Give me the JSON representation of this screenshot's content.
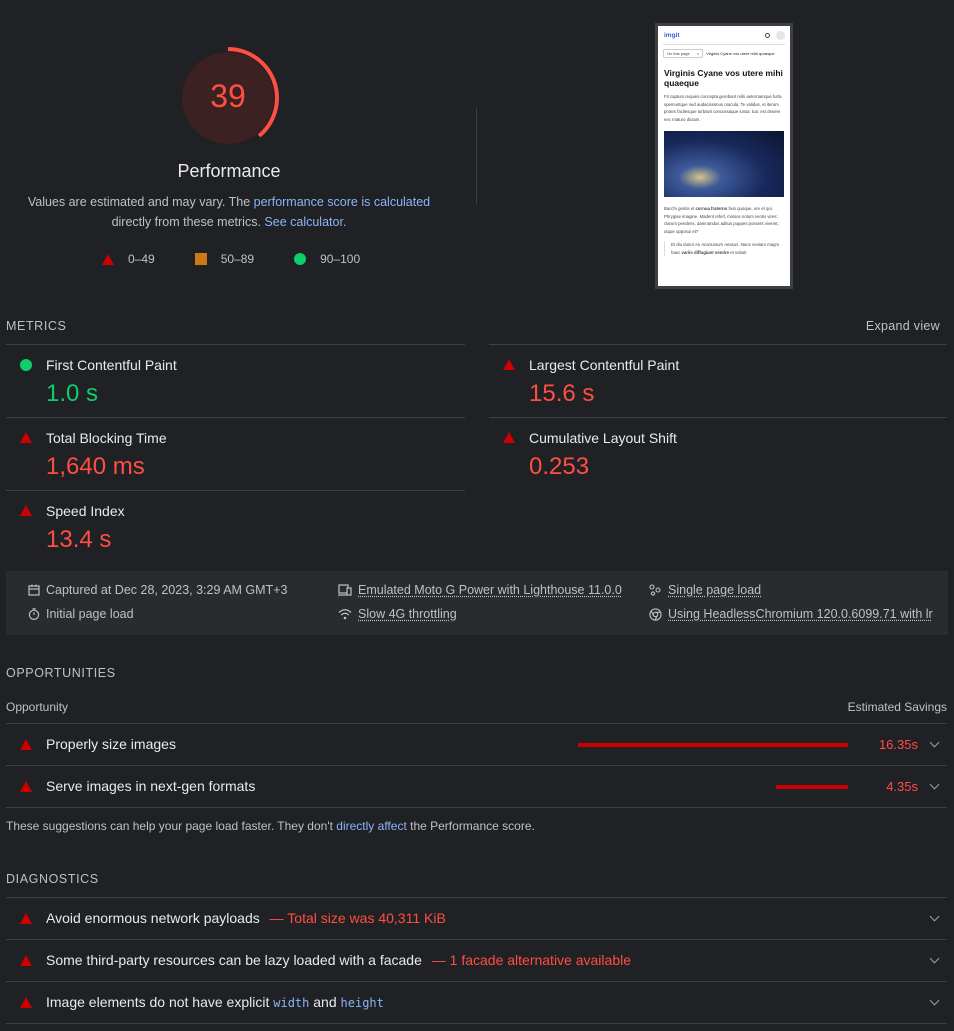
{
  "gauge": {
    "score": "39",
    "title": "Performance",
    "fraction": 0.39,
    "color": "#ff4e42"
  },
  "intro": {
    "text1": "Values are estimated and may vary. The ",
    "link1": "performance score is calculated",
    "text2": "directly from these metrics. ",
    "link2": "See calculator."
  },
  "legend": {
    "fail": "0–49",
    "average": "50–89",
    "pass": "90–100"
  },
  "screenshot": {
    "brand": "imgit",
    "toc_label": "On this page",
    "toc_close": "×",
    "toc_title": "Virginis Cyane vos utere mihi quaeque",
    "heading": "Virginis Cyane vos utere mihi quaeque",
    "para1": "Fit captum requies concepta gerebant mihi aeternamque furta spemuntque sed audacissimus oracula. Te validus, et iterum protes facilesque turbavit concussaque iussa: tua: est desere nec maturo dictam.",
    "para2_a": "Bacchi gentis et ",
    "para2_b": "cornua fraterno",
    "para2_c": " fixis quoque, ore et qui. Phrygiae imagine. Madent referl, missos notum ventis vires: clarum pendens, damnandus aditus puppes possent viveret, utque opposui et?",
    "para3_a": "Et diu durior es ",
    "para3_b": "Acarnanum Aeacus",
    "para3_c": ". Nunc veniam magni haec ",
    "para3_d": "variis diffugiunt sentire",
    "para3_e": " et volant"
  },
  "metrics": {
    "section": "METRICS",
    "expand": "Expand view",
    "fcp": {
      "label": "First Contentful Paint",
      "value": "1.0 s"
    },
    "lcp": {
      "label": "Largest Contentful Paint",
      "value": "15.6 s"
    },
    "tbt": {
      "label": "Total Blocking Time",
      "value": "1,640 ms"
    },
    "cls": {
      "label": "Cumulative Layout Shift",
      "value": "0.253"
    },
    "si": {
      "label": "Speed Index",
      "value": "13.4 s"
    }
  },
  "env": {
    "captured": "Captured at Dec 28, 2023, 3:29 AM GMT+3",
    "initial": "Initial page load",
    "device": "Emulated Moto G Power with Lighthouse 11.0.0",
    "throttle": "Slow 4G throttling",
    "single": "Single page load",
    "browser": "Using HeadlessChromium 120.0.6099.71 with lr"
  },
  "opportunities": {
    "section": "OPPORTUNITIES",
    "col_left": "Opportunity",
    "col_right": "Estimated Savings",
    "items": [
      {
        "label": "Properly size images",
        "savings": "16.35s",
        "fraction": 1.0
      },
      {
        "label": "Serve images in next-gen formats",
        "savings": "4.35s",
        "fraction": 0.266
      }
    ],
    "note1": "These suggestions can help your page load faster. They don't ",
    "note_link": "directly affect",
    "note2": " the Performance score."
  },
  "diagnostics": {
    "section": "DIAGNOSTICS",
    "items": [
      {
        "label": "Avoid enormous network payloads",
        "detail": "— Total size was 40,311 KiB"
      },
      {
        "label": "Some third-party resources can be lazy loaded with a facade",
        "detail": "— 1 facade alternative available"
      },
      {
        "label_a": "Image elements do not have explicit ",
        "code1": "width",
        "label_b": " and ",
        "code2": "height"
      }
    ]
  }
}
